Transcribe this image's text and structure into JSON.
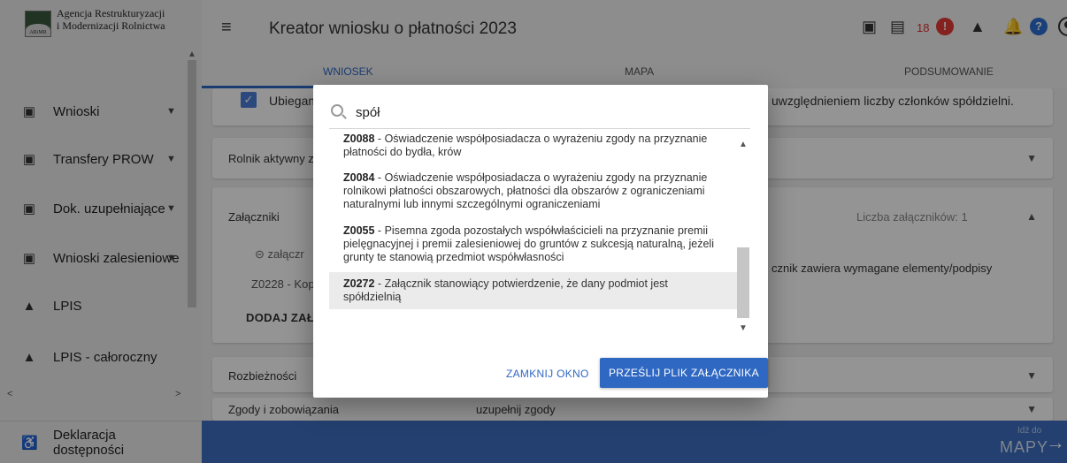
{
  "agency": {
    "line1": "Agencja Restrukturyzacji",
    "line2": "i Modernizacji Rolnictwa",
    "logo_text": "ARiMR"
  },
  "sidebar": {
    "items": [
      {
        "label": "Wnioski",
        "icon": "clipboard-icon",
        "has_chevron": true
      },
      {
        "label": "Transfery PROW",
        "icon": "clipboard-icon",
        "has_chevron": true
      },
      {
        "label": "Dok. uzupełniające",
        "icon": "clipboard-icon",
        "has_chevron": true
      },
      {
        "label": "Wnioski zalesieniowe",
        "icon": "clipboard-icon",
        "has_chevron": true
      },
      {
        "label": "LPIS",
        "icon": "terrain-icon",
        "has_chevron": false
      },
      {
        "label": "LPIS - całoroczny",
        "icon": "terrain-icon",
        "has_chevron": false
      }
    ],
    "accessibility_label": "Deklaracja dostępności"
  },
  "header": {
    "title": "Kreator wniosku o płatności 2023",
    "error_count": "18",
    "alert_symbol": "!",
    "help_symbol": "?"
  },
  "tabs": [
    {
      "label": "WNIOSEK",
      "active": true
    },
    {
      "label": "MAPA",
      "active": false
    },
    {
      "label": "PODSUMOWANIE",
      "active": false
    }
  ],
  "background": {
    "checkbox_label": "Ubiegam",
    "checkbox_suffix": "uwzględnieniem liczby członków spółdzielni.",
    "rolnik_label": "Rolnik aktywny z",
    "zalaczniki_label": "Załączniki",
    "zalaczniki_count": "Liczba załączników: 1",
    "attachment_label": "załączr",
    "attachment_code": "Z0228 - Kopi",
    "attachment_status": "cznik zawiera wymagane elementy/podpisy",
    "add_attachment": "DODAJ ZAŁĄCZ",
    "rozbieznosci_label": "Rozbieżności",
    "zgody_label": "Zgody i zobowiązania",
    "zgody_status": "uzupełnij zgody"
  },
  "bottom_nav": {
    "sub": "Idź do",
    "main": "MAPY"
  },
  "modal": {
    "search_value": "spół",
    "items": [
      {
        "code": "Z0088",
        "text": "Oświadczenie współposiadacza o wyrażeniu zgody na przyznanie płatności do bydła, krów",
        "highlight": false
      },
      {
        "code": "Z0084",
        "text": "Oświadczenie współposiadacza o wyrażeniu zgody na przyznanie rolnikowi płatności obszarowych, płatności dla obszarów z ograniczeniami naturalnymi lub innymi szczególnymi ograniczeniami",
        "highlight": false
      },
      {
        "code": "Z0055",
        "text": "Pisemna zgoda pozostałych współwłaścicieli na przyznanie premii pielęgnacyjnej i premii zalesieniowej do gruntów z sukcesją naturalną, jeżeli grunty te stanowią przedmiot współwłasności",
        "highlight": false
      },
      {
        "code": "Z0272",
        "text": "Załącznik stanowiący potwierdzenie, że dany podmiot jest spółdzielnią",
        "highlight": true
      }
    ],
    "close_label": "ZAMKNIJ OKNO",
    "send_label": "PRZEŚLIJ PLIK ZAŁĄCZNIKA"
  },
  "colors": {
    "primary": "#2f68c3",
    "error": "#e53935",
    "help": "#2b6ed2",
    "status_red": "#d32f2f"
  }
}
